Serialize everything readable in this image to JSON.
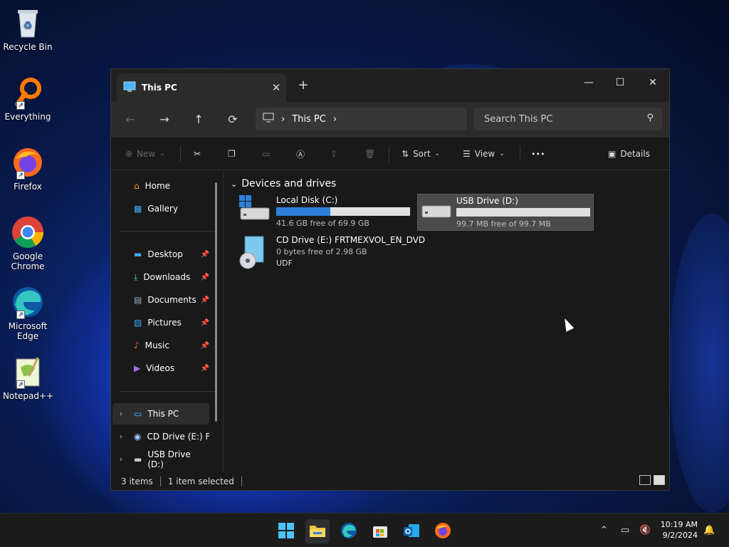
{
  "desktop": {
    "icons": [
      {
        "label": "Recycle Bin"
      },
      {
        "label": "Everything"
      },
      {
        "label": "Firefox"
      },
      {
        "label": "Google Chrome"
      },
      {
        "label": "Microsoft Edge"
      },
      {
        "label": "Notepad++"
      }
    ]
  },
  "window": {
    "tab_title": "This PC",
    "new_tab": "+",
    "controls": {
      "minimize": "—",
      "maximize": "☐",
      "close": "✕"
    },
    "nav": {
      "back": "←",
      "forward": "→",
      "up": "↑",
      "refresh": "⟳"
    },
    "breadcrumb": {
      "item": "This PC",
      "sep": "›"
    },
    "search": {
      "placeholder": "Search This PC"
    },
    "toolbar": {
      "new": "New",
      "sort": "Sort",
      "view": "View",
      "more": "•••",
      "details": "Details"
    },
    "sidebar": {
      "items": [
        {
          "label": "Home"
        },
        {
          "label": "Gallery"
        },
        {
          "label": "Desktop"
        },
        {
          "label": "Downloads"
        },
        {
          "label": "Documents"
        },
        {
          "label": "Pictures"
        },
        {
          "label": "Music"
        },
        {
          "label": "Videos"
        },
        {
          "label": "This PC"
        },
        {
          "label": "CD Drive (E:) FRT"
        },
        {
          "label": "USB Drive (D:)"
        }
      ]
    },
    "content": {
      "group_title": "Devices and drives",
      "drives": [
        {
          "name": "Local Disk (C:)",
          "free": "41.6 GB free of 69.9 GB",
          "used_fraction": 0.405
        },
        {
          "name": "USB Drive (D:)",
          "free": "99.7 MB free of 99.7 MB",
          "used_fraction": 0.0
        },
        {
          "name": "CD Drive (E:) FRTMEXVOL_EN_DVD",
          "free": "0 bytes free of 2.98 GB",
          "fs": "UDF"
        }
      ]
    },
    "status": {
      "items": "3 items",
      "selected": "1 item selected"
    }
  },
  "taskbar": {
    "time": "10:19 AM",
    "date": "9/2/2024"
  },
  "colors": {
    "accent": "#2d7fd9",
    "window_bg": "#191919",
    "taskbar_bg": "#1c1c1c"
  }
}
